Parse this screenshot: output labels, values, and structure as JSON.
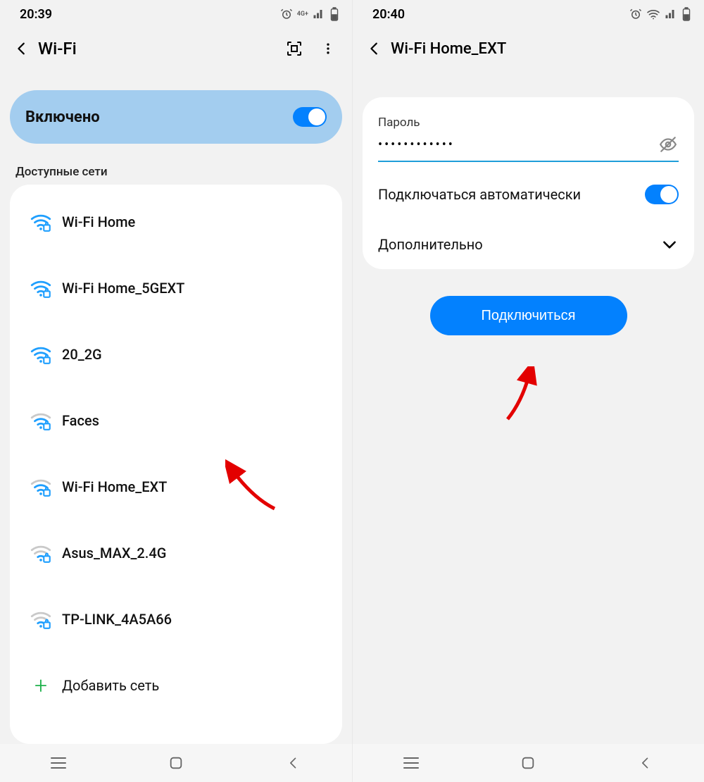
{
  "left": {
    "status_time": "20:39",
    "status_net_label": "4G+",
    "header_title": "Wi-Fi",
    "toggle_label": "Включено",
    "section_label": "Доступные сети",
    "networks": [
      {
        "name": "Wi-Fi Home",
        "locked": true,
        "signal": 4
      },
      {
        "name": "Wi-Fi Home_5GEXT",
        "locked": true,
        "signal": 4
      },
      {
        "name": "20_2G",
        "locked": true,
        "signal": 4
      },
      {
        "name": "Faces",
        "locked": true,
        "signal": 3
      },
      {
        "name": "Wi-Fi Home_EXT",
        "locked": true,
        "signal": 3
      },
      {
        "name": "Asus_MAX_2.4G",
        "locked": true,
        "signal": 2
      },
      {
        "name": "TP-LINK_4A5A66",
        "locked": true,
        "signal": 2
      }
    ],
    "add_network_label": "Добавить сеть"
  },
  "right": {
    "status_time": "20:40",
    "header_title": "Wi-Fi Home_EXT",
    "password_label": "Пароль",
    "password_value": "••••••••••••",
    "auto_connect_label": "Подключаться автоматически",
    "auto_connect_on": true,
    "advanced_label": "Дополнительно",
    "connect_button": "Подключиться"
  }
}
